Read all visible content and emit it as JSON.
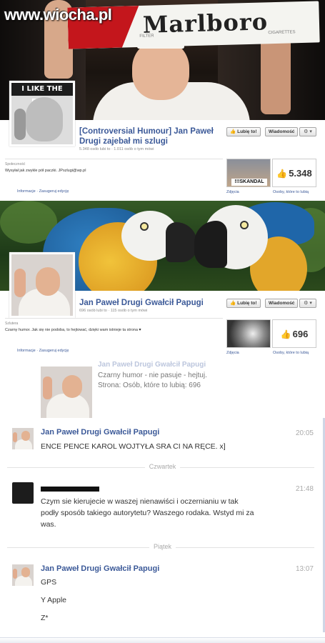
{
  "watermark": "www.wiocha.pl",
  "page1": {
    "cover_brand": "Marlboro",
    "cover_small_left": "FILTER",
    "cover_small_right": "CIGARETTES",
    "profile_header": "I LIKE THE POPE",
    "title": "[Controversial Humour] Jan Paweł Drugi zajebał mi szlugi",
    "meta": "5.348 osób lubi to · 1.011 osób o tym mówi",
    "like_button": "Lubię to!",
    "message_button": "Wiadomość",
    "gear_label": "⚙ ▾",
    "category": "Społeczność",
    "about": "Wysyłał jak zwykle pół paczki. JPszlugi@wp.pl",
    "links": "Informacje · Zasugeruj edycję",
    "thumb_text": "!!!SKANDAL",
    "photos_caption": "Zdjęcia",
    "likes_count": "5.348",
    "likes_caption": "Osoby, które to lubią"
  },
  "page2": {
    "title": "Jan Paweł Drugi Gwałcił Papugi",
    "meta": "696 osób lubi to · 115 osób o tym mówi",
    "like_button": "Lubię to!",
    "message_button": "Wiadomość",
    "gear_label": "⚙ ▾",
    "category": "Szlutera",
    "about": "Czarny humor. Jak się nie podoba, to hejtować, dzięki wam istnieje ta strona ♥",
    "links": "Informacje · Zasugeruj edycję",
    "photos_caption": "Zdjęcia",
    "likes_count": "696",
    "likes_caption": "Osoby, które to lubią"
  },
  "chat": {
    "share_head": "Jan Paweł Drugi Gwałcił Papugi",
    "share_line1": "Czarny humor - nie pasuje - hejtuj.",
    "share_line2": "Strona: Osób, które to lubią: 696",
    "messages": [
      {
        "sender": "Jan Paweł Drugi Gwałcił Papugi",
        "time": "20:05",
        "lines": [
          "ENCE PENCE KAROL WOJTYŁA SRA CI NA RĘCE. x]"
        ]
      },
      {
        "sender": "",
        "time": "21:48",
        "lines": [
          "Czym sie kierujecie w waszej nienawiści i oczernianiu w tak",
          "podły sposób takiego autorytetu? Waszego rodaka. Wstyd mi za",
          "was."
        ]
      },
      {
        "sender": "Jan Paweł Drugi Gwałcił Papugi",
        "time": "13:07",
        "lines": [
          "GPS",
          "Y Apple",
          "Z*"
        ]
      }
    ],
    "dividers": [
      "Czwartek",
      "Piątek"
    ]
  },
  "colors": {
    "fb_blue": "#3b5998",
    "marlboro_red": "#c4161c"
  }
}
